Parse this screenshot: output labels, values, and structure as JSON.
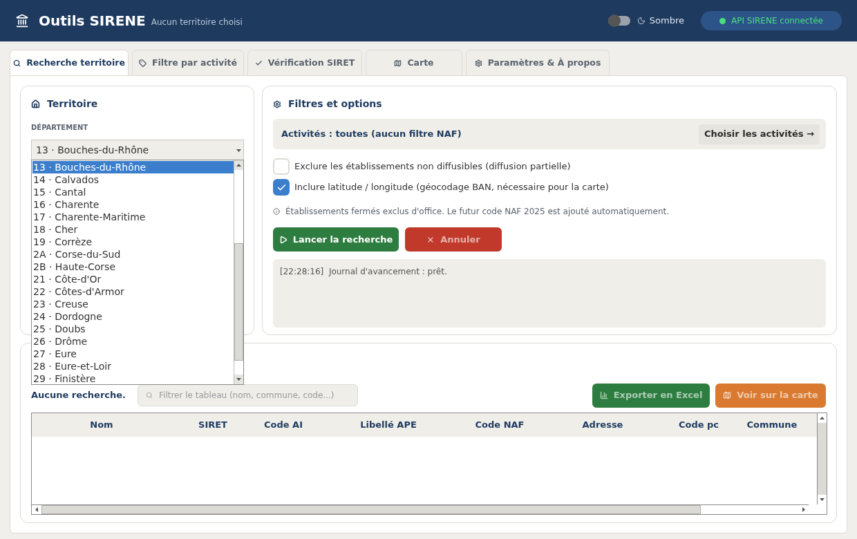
{
  "header": {
    "title": "Outils SIRENE",
    "subtitle": "Aucun territoire choisi",
    "theme_toggle": {
      "label": "Sombre",
      "on": false
    },
    "api_status": {
      "label": "API SIRENE connectée",
      "color": "#4ade80"
    }
  },
  "tabs": [
    {
      "label": "Recherche territoire",
      "selected": true
    },
    {
      "label": "Filtre par activité",
      "selected": false
    },
    {
      "label": "Vérification SIRET",
      "selected": false
    },
    {
      "label": "Carte",
      "selected": false
    },
    {
      "label": "Paramètres & À propos",
      "selected": false
    }
  ],
  "territory": {
    "title": "Territoire",
    "field_label": "DÉPARTEMENT",
    "value": "13 · Bouches-du-Rhône",
    "expanded": true,
    "options": [
      {
        "label": "13 · Bouches-du-Rhône",
        "selected": true
      },
      {
        "label": "14 · Calvados",
        "selected": false
      },
      {
        "label": "15 · Cantal",
        "selected": false
      },
      {
        "label": "16 · Charente",
        "selected": false
      },
      {
        "label": "17 · Charente-Maritime",
        "selected": false
      },
      {
        "label": "18 · Cher",
        "selected": false
      },
      {
        "label": "19 · Corrèze",
        "selected": false
      },
      {
        "label": "2A · Corse-du-Sud",
        "selected": false
      },
      {
        "label": "2B · Haute-Corse",
        "selected": false
      },
      {
        "label": "21 · Côte-d'Or",
        "selected": false
      },
      {
        "label": "22 · Côtes-d'Armor",
        "selected": false
      },
      {
        "label": "23 · Creuse",
        "selected": false
      },
      {
        "label": "24 · Dordogne",
        "selected": false
      },
      {
        "label": "25 · Doubs",
        "selected": false
      },
      {
        "label": "26 · Drôme",
        "selected": false
      },
      {
        "label": "27 · Eure",
        "selected": false
      },
      {
        "label": "28 · Eure-et-Loir",
        "selected": false
      },
      {
        "label": "29 · Finistère",
        "selected": false
      }
    ]
  },
  "filters": {
    "title": "Filtres et options",
    "activities": "Activités : toutes (aucun filtre NAF)",
    "choose_button": "Choisir les activités →",
    "options": [
      {
        "label": "Exclure les établissements non diffusibles (diffusion partielle)",
        "checked": false
      },
      {
        "label": "Inclure latitude / longitude (géocodage BAN, nécessaire pour la carte)",
        "checked": true
      }
    ],
    "note": "Établissements fermés exclus d'office. Le futur code NAF 2025 est ajouté automatiquement.",
    "buttons": [
      {
        "label": "Lancer la recherche",
        "kind": "run",
        "disabled": false
      },
      {
        "label": "Annuler",
        "kind": "cancel",
        "disabled": true
      }
    ],
    "log": [
      {
        "time": "[22:28:16]",
        "message": "Journal d'avancement : prêt."
      }
    ]
  },
  "results": {
    "status": "Aucune recherche.",
    "filter_placeholder": "Filtrer le tableau (nom, commune, code...)",
    "buttons": [
      {
        "label": "Exporter en Excel",
        "kind": "export",
        "disabled": true
      },
      {
        "label": "Voir sur la carte",
        "kind": "map",
        "disabled": true
      }
    ],
    "columns": [
      "Nom",
      "SIRET",
      "Code AI",
      "Libellé APE",
      "Code NAF",
      "Adresse",
      "Code pc",
      "Commune"
    ]
  }
}
